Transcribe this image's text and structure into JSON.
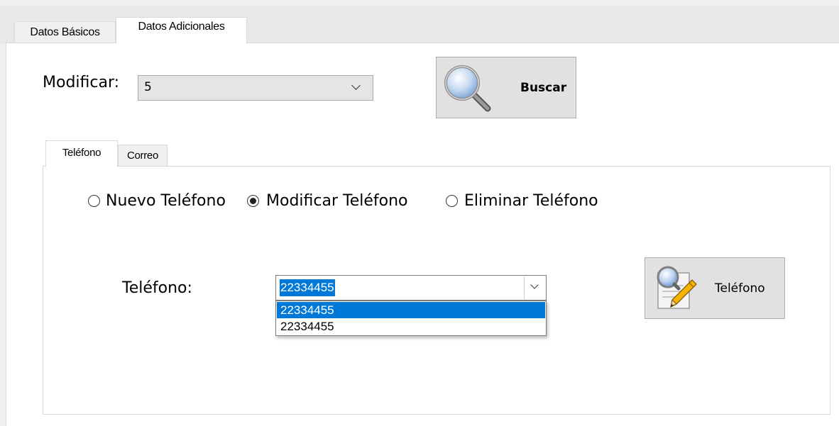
{
  "tabs": {
    "outer": [
      {
        "label": "Datos Básicos"
      },
      {
        "label": "Datos Adicionales"
      }
    ],
    "inner": [
      {
        "label": "Teléfono"
      },
      {
        "label": "Correo"
      }
    ]
  },
  "search": {
    "label": "Modificar:",
    "selected": "5",
    "button_label": "Buscar"
  },
  "phone": {
    "radios": [
      {
        "label": "Nuevo Teléfono",
        "checked": false
      },
      {
        "label": "Modificar Teléfono",
        "checked": true
      },
      {
        "label": "Eliminar Teléfono",
        "checked": false
      }
    ],
    "field_label": "Teléfono:",
    "selected": "22334455",
    "options": [
      "22334455",
      "22334455"
    ],
    "button_label": "Teléfono"
  },
  "colors": {
    "selection": "#0078d7",
    "button_bg": "#e1e1e1",
    "panel_bg": "#ffffff",
    "window_bg": "#f0f0f0"
  }
}
